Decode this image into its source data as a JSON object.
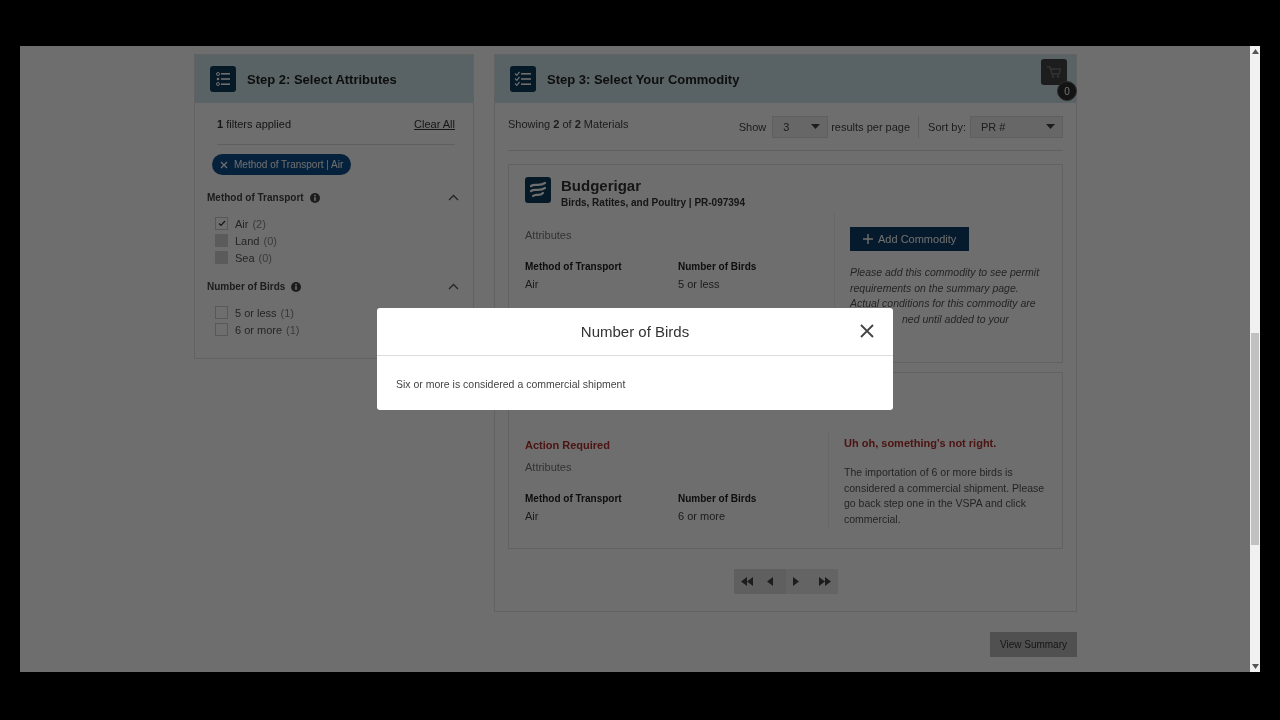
{
  "step2": {
    "title": "Step 2: Select Attributes",
    "filters_applied": "**1** filters applied",
    "clear_all": "Clear All",
    "chips": [
      {
        "label": "Method of Transport | Air"
      }
    ],
    "groups": [
      {
        "title": "Method of Transport",
        "expanded": true,
        "options": [
          {
            "label": "Air",
            "count": "(2)",
            "checked": true,
            "disabled": false
          },
          {
            "label": "Land",
            "count": "(0)",
            "checked": false,
            "disabled": true
          },
          {
            "label": "Sea",
            "count": "(0)",
            "checked": false,
            "disabled": true
          }
        ]
      },
      {
        "title": "Number of Birds",
        "expanded": true,
        "options": [
          {
            "label": "5 or less",
            "count": "(1)",
            "checked": false,
            "disabled": false
          },
          {
            "label": "6 or more",
            "count": "(1)",
            "checked": false,
            "disabled": false
          }
        ]
      }
    ]
  },
  "step3": {
    "title": "Step 3: Select Your Commodity",
    "cart_count": "0",
    "showing": "Showing **2** of **2** Materials",
    "show_label": "Show",
    "per_page": "3",
    "per_page_label": "results per page",
    "sort_label": "Sort by:",
    "sort_value": "PR #",
    "commodities": [
      {
        "kind": "ready",
        "name": "Budgerigar",
        "subtitle": "Birds, Ratites, and Poultry | PR-097394",
        "attributes_label": "Attributes",
        "attributes": [
          {
            "label": "Method of Transport",
            "value": "Air"
          },
          {
            "label": "Number of Birds",
            "value": "5 or less"
          }
        ],
        "action": "Add Commodity",
        "note": "Please add this commodity to see permit requirements on the summary page. Actual conditions for this commodity are",
        "note_tail": "ned until added to your"
      },
      {
        "kind": "error",
        "alert": "Action Required",
        "attributes_label": "Attributes",
        "attributes": [
          {
            "label": "Method of Transport",
            "value": "Air"
          },
          {
            "label": "Number of Birds",
            "value": "6 or more"
          }
        ],
        "error_title": "Uh oh, something's not right.",
        "error_text": "The importation of 6 or more birds is considered a commercial shipment. Please go back step one in the VSPA and click commercial."
      }
    ],
    "view_summary": "View Summary"
  },
  "modal": {
    "title": "Number of Birds",
    "body": "Six or more is considered a commercial shipment"
  }
}
